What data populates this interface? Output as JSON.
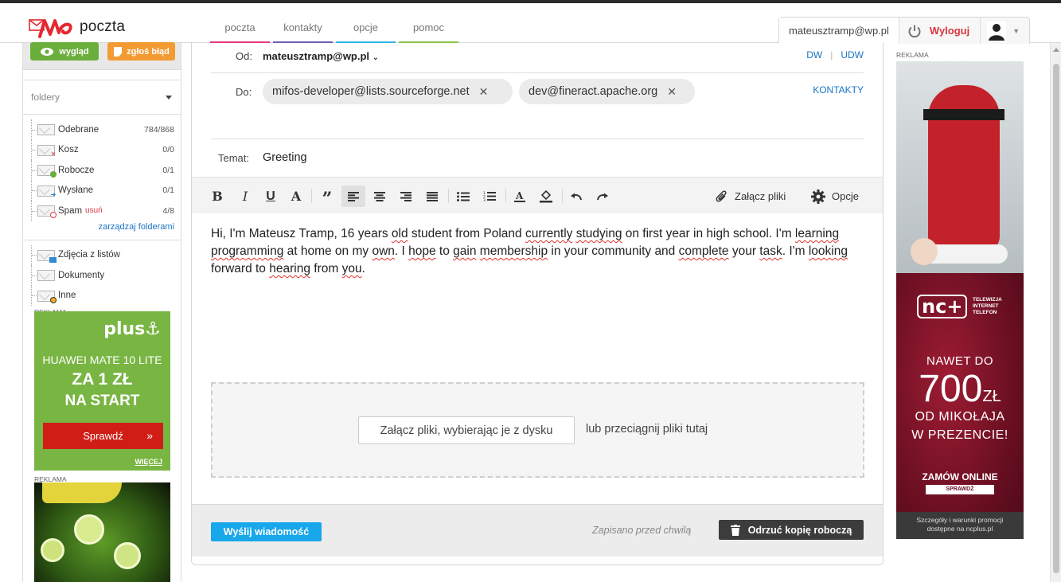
{
  "header": {
    "logo_text": "poczta",
    "nav": [
      {
        "label": "poczta",
        "color": "#e4387f"
      },
      {
        "label": "kontakty",
        "color": "#6a5fb7"
      },
      {
        "label": "opcje",
        "color": "#33b5e5"
      },
      {
        "label": "pomoc",
        "color": "#8bc34a"
      }
    ],
    "user_email": "mateusztramp@wp.pl",
    "logout_label": "Wyloguj"
  },
  "sidebar": {
    "wyglad_label": "wygląd",
    "zglos_label": "zgłoś błąd",
    "folders_label": "foldery",
    "folders": [
      {
        "name": "Odebrane",
        "count": "784/868"
      },
      {
        "name": "Kosz",
        "count": "0/0"
      },
      {
        "name": "Robocze",
        "count": "0/1"
      },
      {
        "name": "Wysłane",
        "count": "0/1"
      },
      {
        "name": "Spam",
        "count": "4/8",
        "extra": "usuń"
      }
    ],
    "manage_label": "zarządzaj folderami",
    "extra_folders": [
      {
        "name": "Zdjęcia z listów"
      },
      {
        "name": "Dokumenty"
      },
      {
        "name": "Inne"
      }
    ],
    "ad1": {
      "label": "REKLAMA",
      "brand": "plus",
      "line1": "HUAWEI MATE 10 LITE",
      "line2": "ZA 1 ZŁ",
      "line3": "NA START",
      "cta": "Sprawdź",
      "more": "WIĘCEJ"
    },
    "ad2_label": "REKLAMA"
  },
  "compose": {
    "from_label": "Od:",
    "from_value": "mateusztramp@wp.pl",
    "dw_label": "DW",
    "udw_label": "UDW",
    "to_label": "Do:",
    "recipients": [
      "mifos-developer@lists.sourceforge.net",
      "dev@fineract.apache.org"
    ],
    "kontakty_label": "KONTAKTY",
    "subject_label": "Temat:",
    "subject_value": "Greeting",
    "toolbar": {
      "attach_label": "Załącz pliki",
      "options_label": "Opcje"
    },
    "body": {
      "t1": "Hi, I'm Mateusz Tramp, 16 years ",
      "w1": "old",
      "t2": " student from Poland ",
      "w2": "currently",
      "t3": " ",
      "w3": "studying",
      "t4": " on first year in high school. I'm ",
      "w4": "learning",
      "t5": " ",
      "w5": "programming",
      "t6": " at home on my ",
      "w6": "own",
      "t7": ". I ",
      "w7": "hope",
      "t8": " to ",
      "w8": "gain",
      "t9": " ",
      "w9": "membership",
      "t10": " in your community and ",
      "w10": "complete",
      "t11": " your ",
      "w11": "task",
      "t12": ". I'm ",
      "w12": "looking",
      "t13": " forward to ",
      "w13": "hearing",
      "t14": " from ",
      "w14": "you",
      "t15": "."
    },
    "dropzone_button": "Załącz pliki, wybierając je z dysku",
    "dropzone_or": "lub przeciągnij pliki tutaj",
    "send_label": "Wyślij wiadomość",
    "saved_label": "Zapisano przed chwilą",
    "discard_label": "Odrzuć kopię roboczą"
  },
  "right_ads": {
    "label": "REKLAMA",
    "nc_logo": "nc+",
    "nc_small": [
      "TELEWIZJA",
      "INTERNET",
      "TELEFON"
    ],
    "nc_line1": "NAWET DO",
    "nc_amount": "700",
    "nc_currency": "ZŁ",
    "nc_line3": "OD MIKOŁAJA",
    "nc_line4": "W PREZENCIE!",
    "nc_cta": "ZAMÓW ONLINE",
    "nc_cta_small": "SPRAWDŹ",
    "nc_foot1": "Szczegóły i warunki promocji",
    "nc_foot2": "dostępne na ncplus.pl"
  }
}
